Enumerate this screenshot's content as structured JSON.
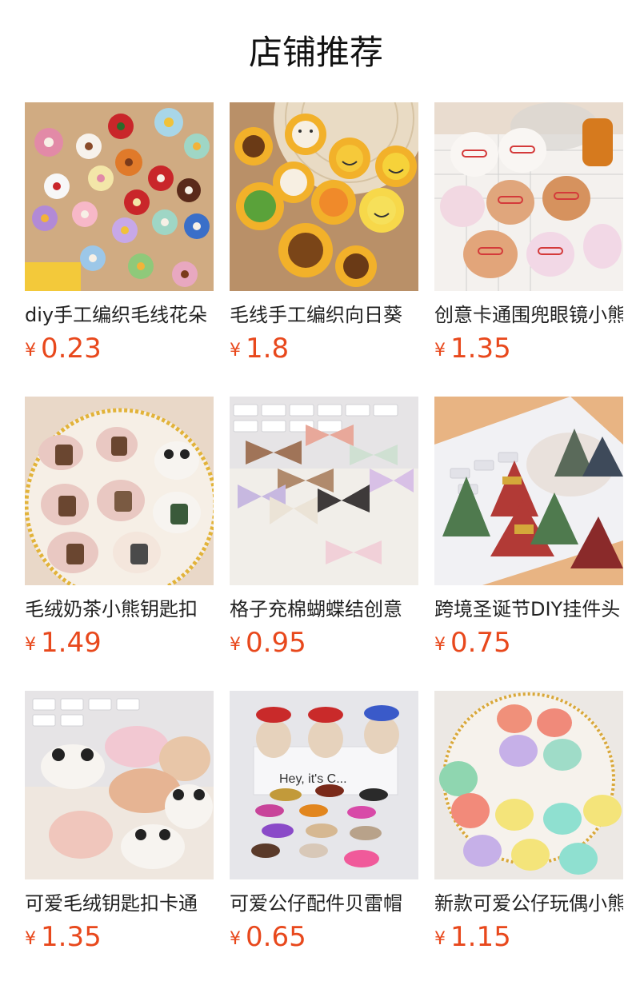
{
  "header": {
    "title": "店铺推荐"
  },
  "currency_symbol": "¥",
  "products": [
    {
      "title": "diy手工编织毛线花朵",
      "price": "0.23"
    },
    {
      "title": "毛线手工编织向日葵",
      "price": "1.8"
    },
    {
      "title": "创意卡通围兜眼镜小熊",
      "price": "1.35"
    },
    {
      "title": "毛绒奶茶小熊钥匙扣",
      "price": "1.49"
    },
    {
      "title": "格子充棉蝴蝶结创意",
      "price": "0.95"
    },
    {
      "title": "跨境圣诞节DIY挂件头",
      "price": "0.75"
    },
    {
      "title": "可爱毛绒钥匙扣卡通",
      "price": "1.35"
    },
    {
      "title": "可爱公仔配件贝雷帽",
      "price": "0.65"
    },
    {
      "title": "新款可爱公仔玩偶小熊",
      "price": "1.15"
    }
  ]
}
